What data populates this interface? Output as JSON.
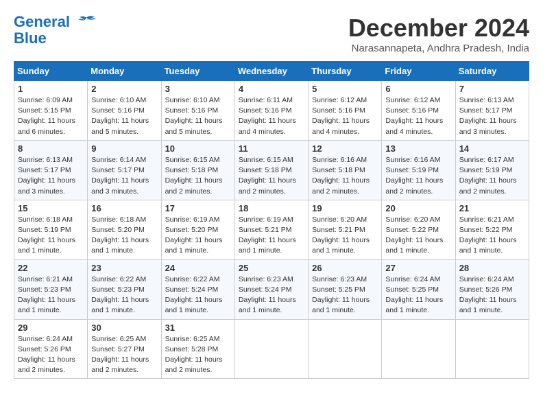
{
  "header": {
    "logo_line1": "General",
    "logo_line2": "Blue",
    "month": "December 2024",
    "location": "Narasannapeta, Andhra Pradesh, India"
  },
  "weekdays": [
    "Sunday",
    "Monday",
    "Tuesday",
    "Wednesday",
    "Thursday",
    "Friday",
    "Saturday"
  ],
  "weeks": [
    [
      {
        "day": 1,
        "sunrise": "6:09 AM",
        "sunset": "5:15 PM",
        "daylight": "11 hours and 6 minutes."
      },
      {
        "day": 2,
        "sunrise": "6:10 AM",
        "sunset": "5:16 PM",
        "daylight": "11 hours and 5 minutes."
      },
      {
        "day": 3,
        "sunrise": "6:10 AM",
        "sunset": "5:16 PM",
        "daylight": "11 hours and 5 minutes."
      },
      {
        "day": 4,
        "sunrise": "6:11 AM",
        "sunset": "5:16 PM",
        "daylight": "11 hours and 4 minutes."
      },
      {
        "day": 5,
        "sunrise": "6:12 AM",
        "sunset": "5:16 PM",
        "daylight": "11 hours and 4 minutes."
      },
      {
        "day": 6,
        "sunrise": "6:12 AM",
        "sunset": "5:16 PM",
        "daylight": "11 hours and 4 minutes."
      },
      {
        "day": 7,
        "sunrise": "6:13 AM",
        "sunset": "5:17 PM",
        "daylight": "11 hours and 3 minutes."
      }
    ],
    [
      {
        "day": 8,
        "sunrise": "6:13 AM",
        "sunset": "5:17 PM",
        "daylight": "11 hours and 3 minutes."
      },
      {
        "day": 9,
        "sunrise": "6:14 AM",
        "sunset": "5:17 PM",
        "daylight": "11 hours and 3 minutes."
      },
      {
        "day": 10,
        "sunrise": "6:15 AM",
        "sunset": "5:18 PM",
        "daylight": "11 hours and 2 minutes."
      },
      {
        "day": 11,
        "sunrise": "6:15 AM",
        "sunset": "5:18 PM",
        "daylight": "11 hours and 2 minutes."
      },
      {
        "day": 12,
        "sunrise": "6:16 AM",
        "sunset": "5:18 PM",
        "daylight": "11 hours and 2 minutes."
      },
      {
        "day": 13,
        "sunrise": "6:16 AM",
        "sunset": "5:19 PM",
        "daylight": "11 hours and 2 minutes."
      },
      {
        "day": 14,
        "sunrise": "6:17 AM",
        "sunset": "5:19 PM",
        "daylight": "11 hours and 2 minutes."
      }
    ],
    [
      {
        "day": 15,
        "sunrise": "6:18 AM",
        "sunset": "5:19 PM",
        "daylight": "11 hours and 1 minute."
      },
      {
        "day": 16,
        "sunrise": "6:18 AM",
        "sunset": "5:20 PM",
        "daylight": "11 hours and 1 minute."
      },
      {
        "day": 17,
        "sunrise": "6:19 AM",
        "sunset": "5:20 PM",
        "daylight": "11 hours and 1 minute."
      },
      {
        "day": 18,
        "sunrise": "6:19 AM",
        "sunset": "5:21 PM",
        "daylight": "11 hours and 1 minute."
      },
      {
        "day": 19,
        "sunrise": "6:20 AM",
        "sunset": "5:21 PM",
        "daylight": "11 hours and 1 minute."
      },
      {
        "day": 20,
        "sunrise": "6:20 AM",
        "sunset": "5:22 PM",
        "daylight": "11 hours and 1 minute."
      },
      {
        "day": 21,
        "sunrise": "6:21 AM",
        "sunset": "5:22 PM",
        "daylight": "11 hours and 1 minute."
      }
    ],
    [
      {
        "day": 22,
        "sunrise": "6:21 AM",
        "sunset": "5:23 PM",
        "daylight": "11 hours and 1 minute."
      },
      {
        "day": 23,
        "sunrise": "6:22 AM",
        "sunset": "5:23 PM",
        "daylight": "11 hours and 1 minute."
      },
      {
        "day": 24,
        "sunrise": "6:22 AM",
        "sunset": "5:24 PM",
        "daylight": "11 hours and 1 minute."
      },
      {
        "day": 25,
        "sunrise": "6:23 AM",
        "sunset": "5:24 PM",
        "daylight": "11 hours and 1 minute."
      },
      {
        "day": 26,
        "sunrise": "6:23 AM",
        "sunset": "5:25 PM",
        "daylight": "11 hours and 1 minute."
      },
      {
        "day": 27,
        "sunrise": "6:24 AM",
        "sunset": "5:25 PM",
        "daylight": "11 hours and 1 minute."
      },
      {
        "day": 28,
        "sunrise": "6:24 AM",
        "sunset": "5:26 PM",
        "daylight": "11 hours and 1 minute."
      }
    ],
    [
      {
        "day": 29,
        "sunrise": "6:24 AM",
        "sunset": "5:26 PM",
        "daylight": "11 hours and 2 minutes."
      },
      {
        "day": 30,
        "sunrise": "6:25 AM",
        "sunset": "5:27 PM",
        "daylight": "11 hours and 2 minutes."
      },
      {
        "day": 31,
        "sunrise": "6:25 AM",
        "sunset": "5:28 PM",
        "daylight": "11 hours and 2 minutes."
      },
      null,
      null,
      null,
      null
    ]
  ]
}
